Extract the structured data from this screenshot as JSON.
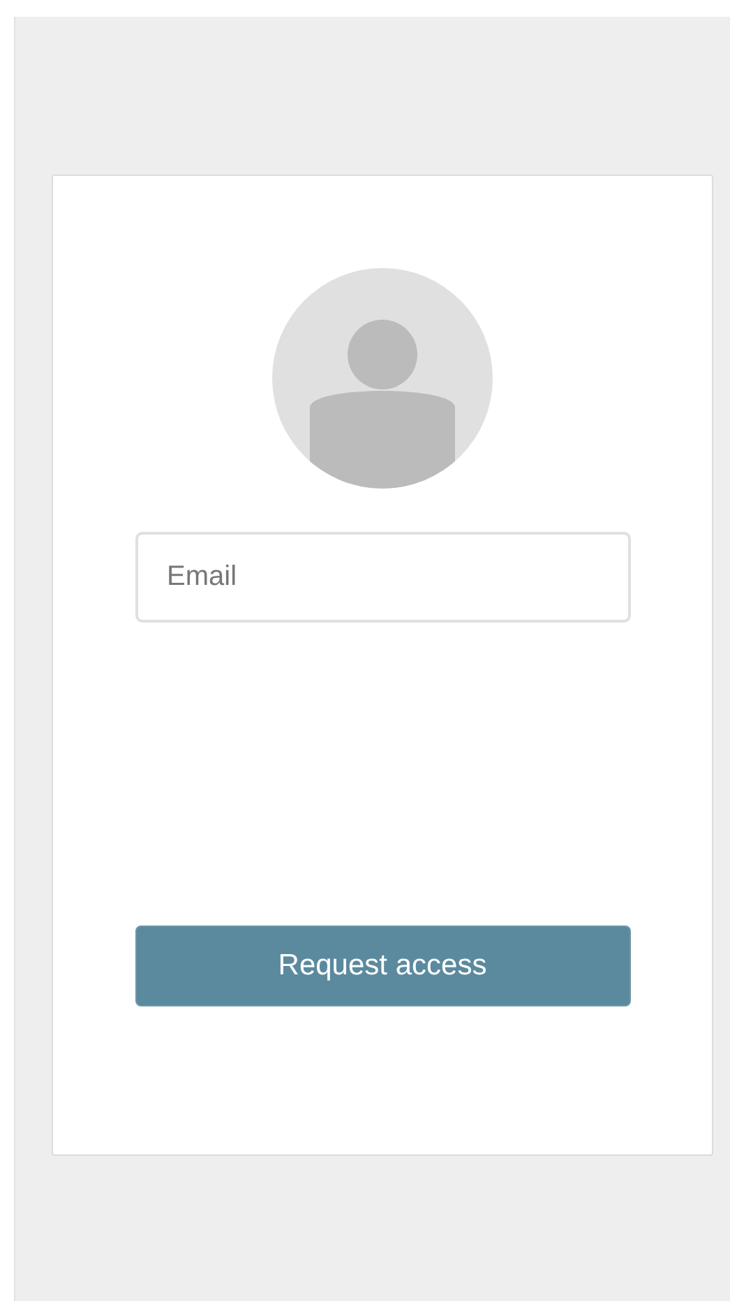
{
  "email": {
    "placeholder": "Email"
  },
  "button": {
    "label": "Request access"
  }
}
